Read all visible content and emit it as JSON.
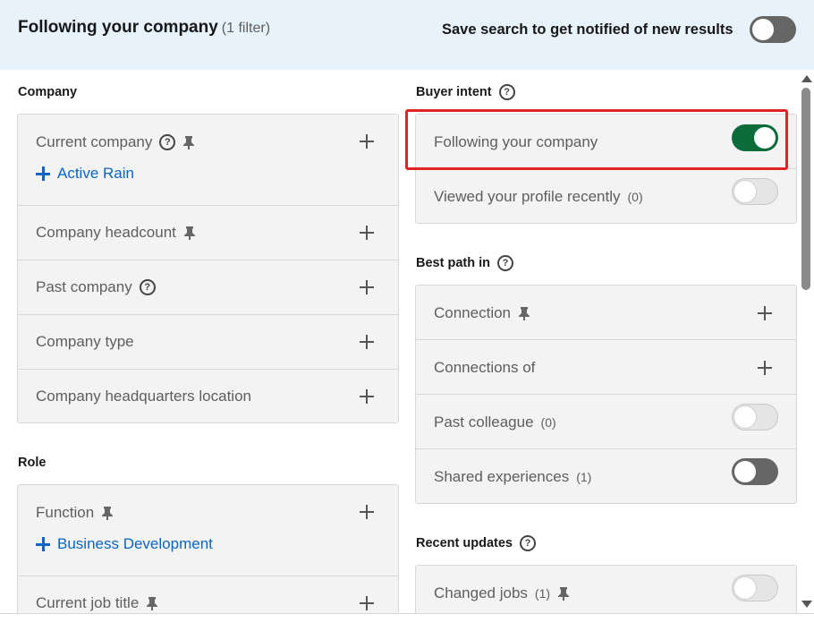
{
  "header": {
    "title": "Following your company",
    "filter_count": "(1 filter)",
    "save_label": "Save search to get notified of new results"
  },
  "left": {
    "company_section": "Company",
    "company_rows": [
      {
        "label": "Current company",
        "added": "Active Rain"
      },
      {
        "label": "Company headcount"
      },
      {
        "label": "Past company"
      },
      {
        "label": "Company type"
      },
      {
        "label": "Company headquarters location"
      }
    ],
    "role_section": "Role",
    "role_rows": [
      {
        "label": "Function",
        "added": "Business Development"
      },
      {
        "label": "Current job title"
      }
    ]
  },
  "right": {
    "buyer_intent_section": "Buyer intent",
    "buyer_rows": [
      {
        "label": "Following your company",
        "toggle": "on"
      },
      {
        "label": "Viewed your profile recently",
        "count": "(0)",
        "toggle": "off"
      }
    ],
    "best_path_section": "Best path in",
    "best_path_rows": [
      {
        "label": "Connection"
      },
      {
        "label": "Connections of"
      },
      {
        "label": "Past colleague",
        "count": "(0)",
        "toggle": "off"
      },
      {
        "label": "Shared experiences",
        "count": "(1)",
        "toggle": "off"
      }
    ],
    "recent_updates_section": "Recent updates",
    "recent_rows": [
      {
        "label": "Changed jobs",
        "count": "(1)",
        "toggle": "off"
      }
    ]
  },
  "icons": {
    "help": "help-circle-icon",
    "pin": "pin-icon",
    "plus": "plus-icon"
  },
  "colors": {
    "header_bg": "#e7f2fb",
    "toggle_on": "#0b6b3a",
    "link_blue": "#0a66c2",
    "highlight": "#e02424"
  }
}
